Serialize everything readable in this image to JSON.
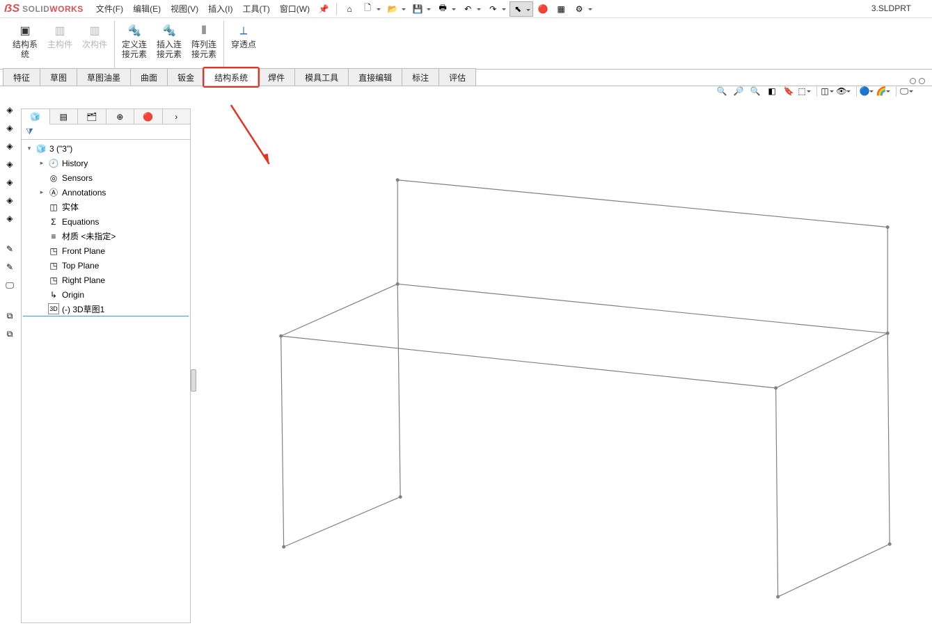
{
  "app": {
    "brand_solid": "SOLID",
    "brand_works": "WORKS",
    "document": "3.SLDPRT"
  },
  "menu": {
    "file": "文件(F)",
    "edit": "编辑(E)",
    "view": "视图(V)",
    "insert": "插入(I)",
    "tool": "工具(T)",
    "window": "窗口(W)"
  },
  "ribbon": {
    "btn1": "结构系\n统",
    "btn2": "主构件",
    "btn3": "次构件",
    "btn4": "定义连\n接元素",
    "btn5": "插入连\n接元素",
    "btn6": "阵列连\n接元素",
    "btn7": "穿透点"
  },
  "tabs": {
    "t1": "特征",
    "t2": "草图",
    "t3": "草图油墨",
    "t4": "曲面",
    "t5": "钣金",
    "t6": "结构系统",
    "t7": "焊件",
    "t8": "模具工具",
    "t9": "直接编辑",
    "t10": "标注",
    "t11": "评估"
  },
  "tree": {
    "root": "3 (\"3\")",
    "history": "History",
    "sensors": "Sensors",
    "annotations": "Annotations",
    "solid": "实体",
    "equations": "Equations",
    "material": "材质 <未指定>",
    "front": "Front Plane",
    "top": "Top Plane",
    "right": "Right Plane",
    "origin": "Origin",
    "sketch3d": "(-) 3D草图1"
  }
}
